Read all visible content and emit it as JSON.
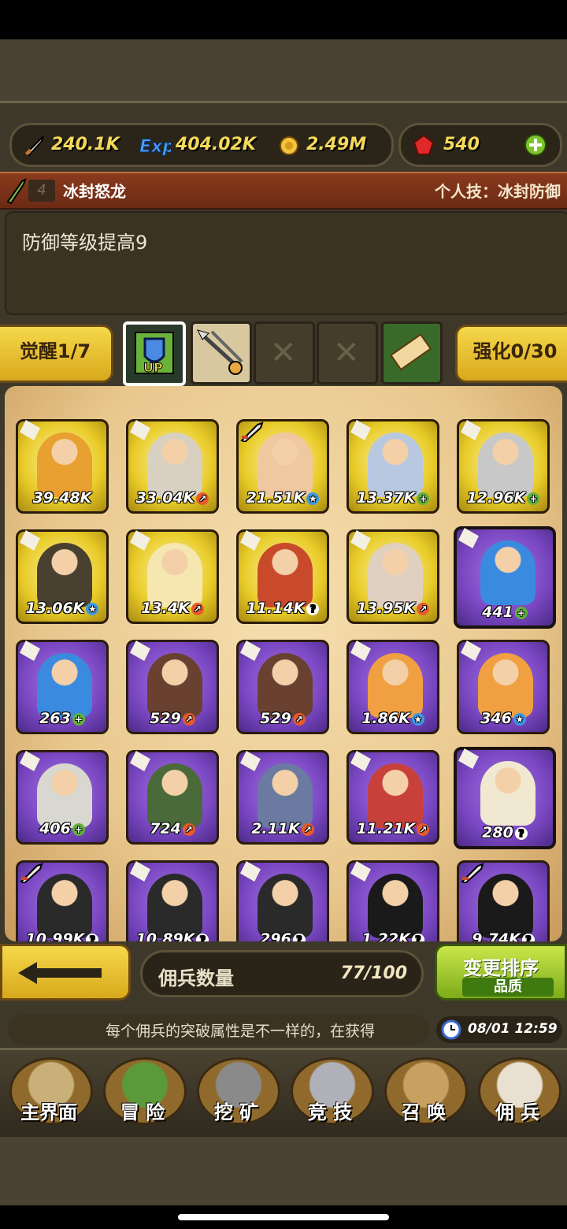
{
  "resources": {
    "attack": "240.1K",
    "exp": "404.02K",
    "gold": "2.49M",
    "gems": "540"
  },
  "skill": {
    "level": "4",
    "name": "冰封怒龙",
    "personal": "个人技：冰封防御",
    "description": "防御等级提高9"
  },
  "awaken": {
    "label": "觉醒1/7"
  },
  "enhance": {
    "label": "强化0/30"
  },
  "cards": [
    {
      "value": "39.48K",
      "tag": "",
      "frame": "gold"
    },
    {
      "value": "33.04K",
      "tag": "arrow",
      "frame": "gold"
    },
    {
      "value": "21.51K",
      "tag": "star",
      "frame": "gold"
    },
    {
      "value": "13.37K",
      "tag": "plus",
      "frame": "gold"
    },
    {
      "value": "12.96K",
      "tag": "plus",
      "frame": "gold"
    },
    {
      "value": "13.06K",
      "tag": "star",
      "frame": "gold"
    },
    {
      "value": "13.4K",
      "tag": "arrow",
      "frame": "gold"
    },
    {
      "value": "11.14K",
      "tag": "q",
      "frame": "gold"
    },
    {
      "value": "13.95K",
      "tag": "arrow",
      "frame": "gold"
    },
    {
      "value": "441",
      "tag": "plus",
      "frame": "purple"
    },
    {
      "value": "263",
      "tag": "plus",
      "frame": "purple"
    },
    {
      "value": "529",
      "tag": "arrow",
      "frame": "purple"
    },
    {
      "value": "529",
      "tag": "arrow",
      "frame": "purple"
    },
    {
      "value": "1.86K",
      "tag": "star",
      "frame": "purple"
    },
    {
      "value": "346",
      "tag": "star",
      "frame": "purple"
    },
    {
      "value": "406",
      "tag": "plus",
      "frame": "purple"
    },
    {
      "value": "724",
      "tag": "arrow",
      "frame": "purple"
    },
    {
      "value": "2.11K",
      "tag": "arrow",
      "frame": "purple"
    },
    {
      "value": "11.21K",
      "tag": "arrow",
      "frame": "purple"
    },
    {
      "value": "280",
      "tag": "q",
      "frame": "purple"
    },
    {
      "value": "10.99K",
      "tag": "q",
      "frame": "purple"
    },
    {
      "value": "10.89K",
      "tag": "q",
      "frame": "purple"
    },
    {
      "value": "296",
      "tag": "q",
      "frame": "purple"
    },
    {
      "value": "1.22K",
      "tag": "q",
      "frame": "purple"
    },
    {
      "value": "9.74K",
      "tag": "q",
      "frame": "purple"
    }
  ],
  "mercenary": {
    "count_label": "佣兵数量",
    "count_value": "77/100"
  },
  "sort": {
    "title": "变更排序",
    "mode": "品质"
  },
  "ticker": "每个佣兵的突破属性是不一样的，在获得",
  "clock": "08/01 12:59",
  "nav": [
    "主界面",
    "冒 险",
    "挖 矿",
    "竞 技",
    "召 唤",
    "佣 兵"
  ],
  "colors": {
    "gold_frame": "#e8cb28",
    "purple_frame": "#7a47c2",
    "accent_yellow": "#f5d84a",
    "accent_green": "#7dab1a"
  }
}
